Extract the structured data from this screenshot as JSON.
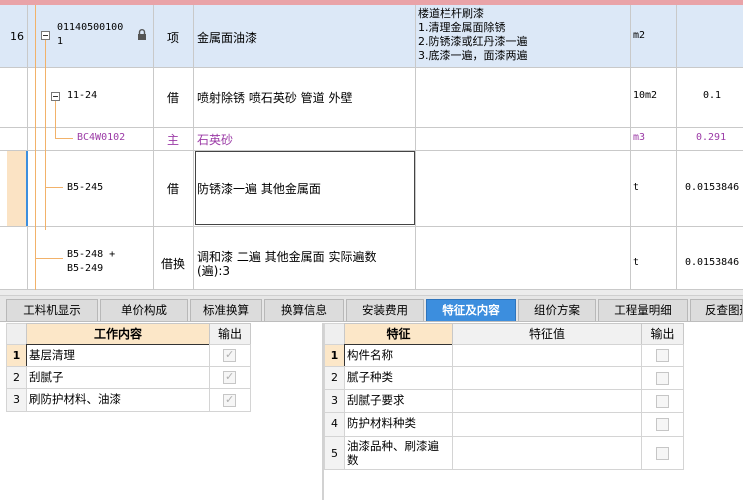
{
  "grid": {
    "row16": {
      "row_no": "16",
      "code_line1": "01140500100",
      "code_line2": "1",
      "type": "项",
      "name": "金属面油漆",
      "feature_lines": [
        "楼道栏杆刷漆",
        "1.清理金属面除锈",
        "2.防锈漆或红丹漆一遍",
        "3.底漆一遍，面漆两遍"
      ],
      "unit": "m2",
      "qty": ""
    },
    "rows": [
      {
        "code": "11-24",
        "type": "借",
        "name": "喷射除锈 喷石英砂 管道 外壁",
        "unit": "10m2",
        "qty": "0.1"
      },
      {
        "code": "BC4W0102",
        "type": "主",
        "name": "石英砂",
        "unit": "m3",
        "qty": "0.291"
      },
      {
        "code": "B5-245",
        "type": "借",
        "name": "防锈漆一遍 其他金属面",
        "unit": "t",
        "qty": "0.0153846"
      },
      {
        "code_line1": "B5-248 +",
        "code_line2": "B5-249",
        "type": "借换",
        "name_line1": "调和漆 二遍 其他金属面  实际遍数",
        "name_line2": "(遍):3",
        "unit": "t",
        "qty": "0.0153846"
      }
    ]
  },
  "tabs": [
    "工料机显示",
    "单价构成",
    "标准换算",
    "换算信息",
    "安装费用",
    "特征及内容",
    "组价方案",
    "工程量明细",
    "反查图形"
  ],
  "active_tab": "特征及内容",
  "work_table": {
    "headers": [
      "工作内容",
      "输出"
    ],
    "rows": [
      {
        "no": "1",
        "content": "基层清理"
      },
      {
        "no": "2",
        "content": "刮腻子"
      },
      {
        "no": "3",
        "content": "刷防护材料、油漆"
      }
    ]
  },
  "feature_table": {
    "headers": [
      "特征",
      "特征值",
      "输出"
    ],
    "rows": [
      {
        "no": "1",
        "name": "构件名称",
        "value": ""
      },
      {
        "no": "2",
        "name": "腻子种类",
        "value": ""
      },
      {
        "no": "3",
        "name": "刮腻子要求",
        "value": ""
      },
      {
        "no": "4",
        "name": "防护材料种类",
        "value": ""
      },
      {
        "no": "5",
        "name_line1": "油漆品种、刷漆遍",
        "name_line2": "数",
        "value": ""
      }
    ]
  },
  "colors": {
    "accent": "#3c8ede",
    "header_bg": "#fce7c8",
    "main_material": "#9b3aa6",
    "row_selected": "#dce8f7"
  }
}
